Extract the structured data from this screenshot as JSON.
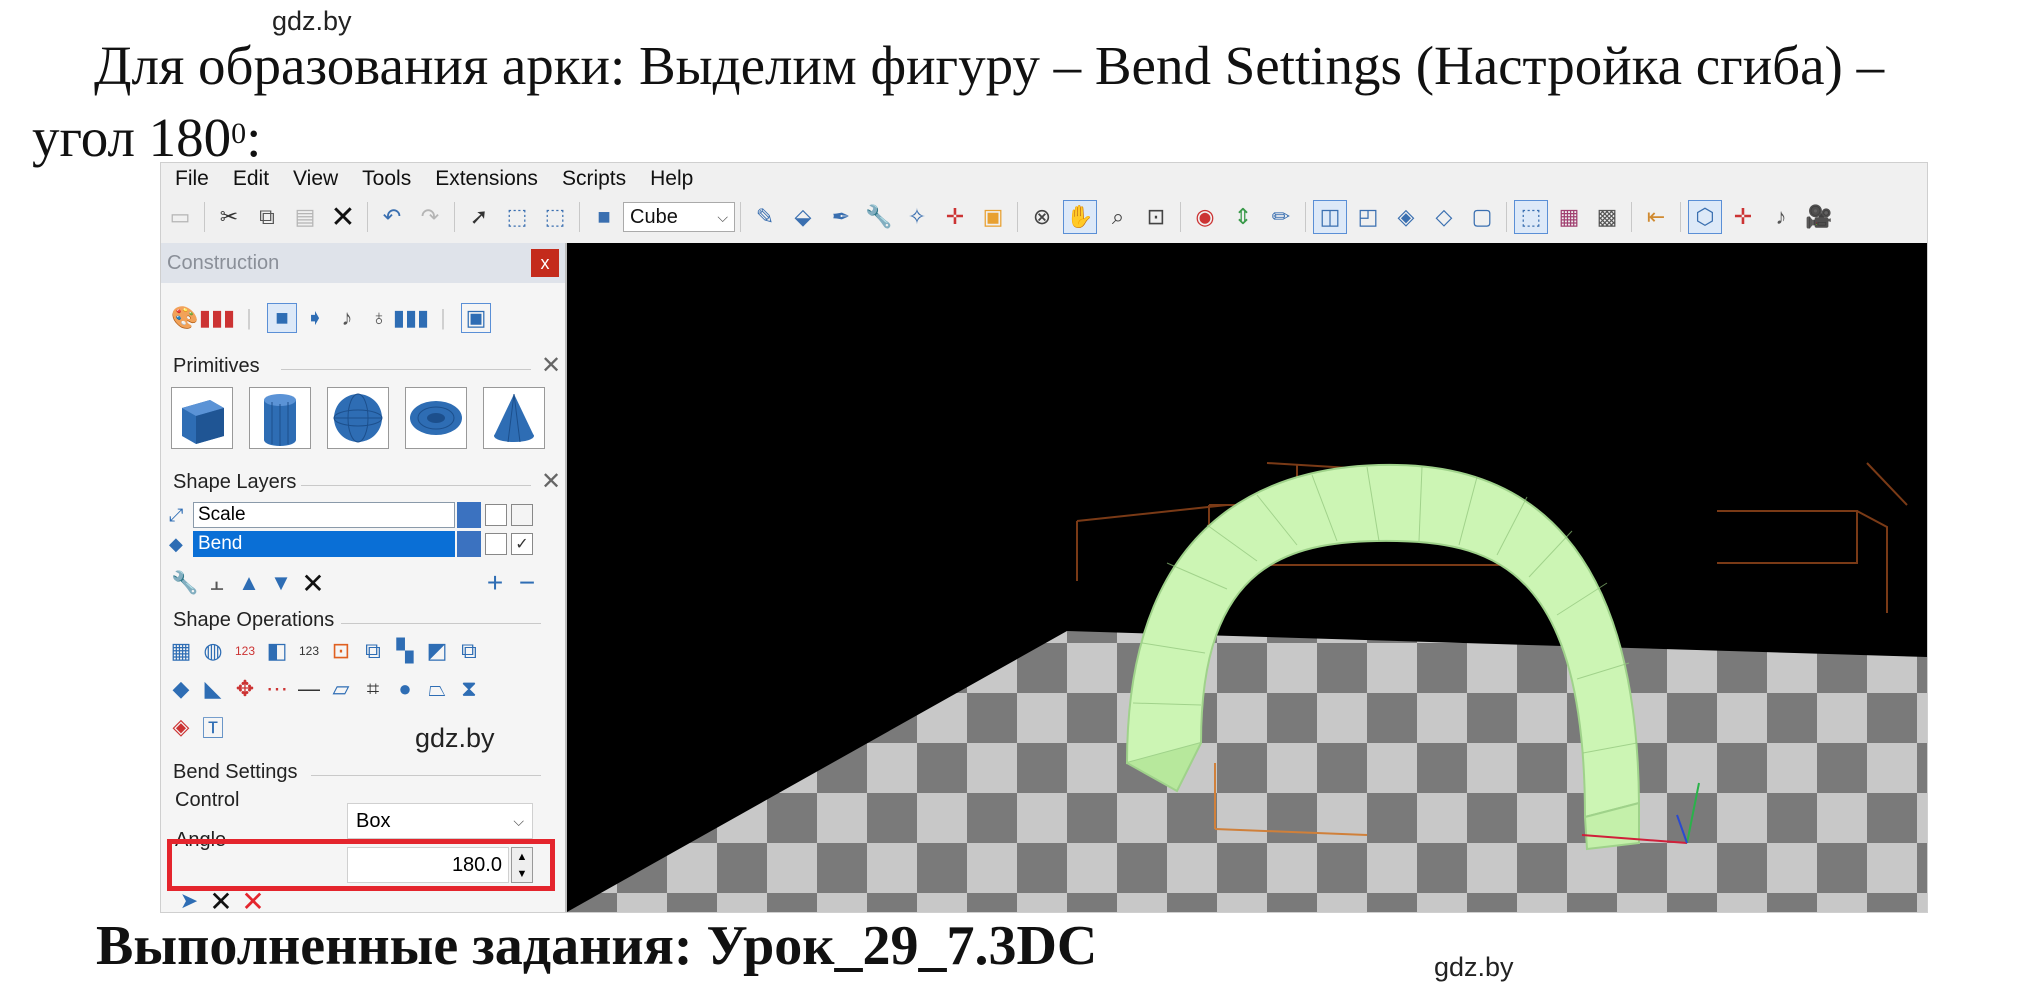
{
  "watermarks": [
    "gdz.by",
    "gdz.by",
    "gdz.by"
  ],
  "intro": {
    "line1": "Для образования арки: Выделим фигуру – Bend Settings (Настройка сгиба) –",
    "line2_prefix": "угол 180",
    "line2_sup": "0",
    "line2_suffix": ":"
  },
  "menu": [
    "File",
    "Edit",
    "View",
    "Tools",
    "Extensions",
    "Scripts",
    "Help"
  ],
  "toolbar": {
    "shape_select": "Cube"
  },
  "panel": {
    "title": "Construction",
    "close": "x",
    "primitives_label": "Primitives",
    "primitives": [
      "cube",
      "cylinder",
      "sphere",
      "torus",
      "cone"
    ],
    "shape_layers_label": "Shape Layers",
    "layers": [
      {
        "name": "Scale",
        "checked": false,
        "selected": false
      },
      {
        "name": "Bend",
        "checked": true,
        "selected": true
      }
    ],
    "shape_operations_label": "Shape Operations",
    "bend_settings_label": "Bend Settings",
    "control_label": "Control",
    "control_value": "Box",
    "angle_label": "Angle",
    "angle_value": "180.0"
  },
  "footer": "Выполненные задания: Урок_29_7.3DC",
  "colors": {
    "accent": "#2e6db4",
    "selected_layer": "#0a6fd6",
    "highlight_frame": "#e4252d",
    "arch": "#ccf5b4",
    "floor_light": "#c8c8c8",
    "floor_dark": "#7a7a7a"
  }
}
